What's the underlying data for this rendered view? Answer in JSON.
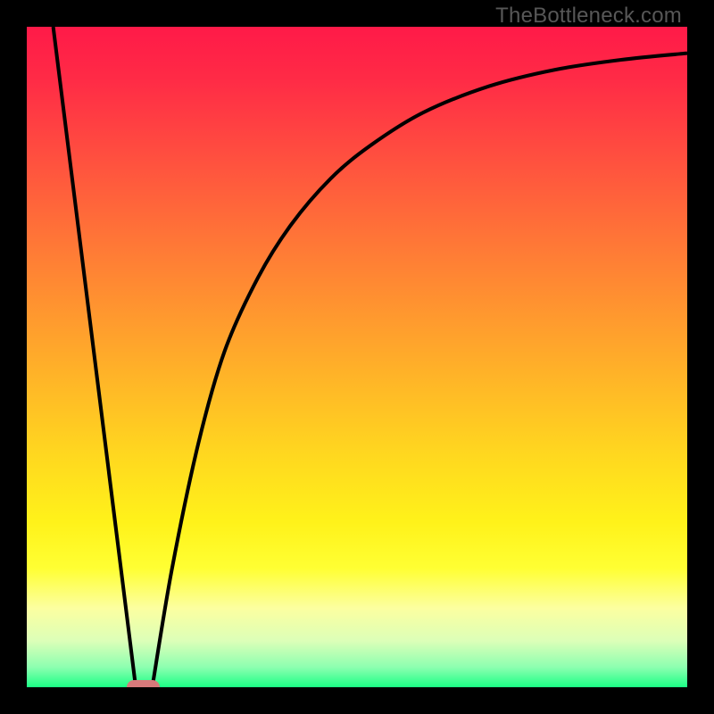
{
  "watermark": "TheBottleneck.com",
  "colors": {
    "gradient_stops": [
      {
        "offset": 0.0,
        "color": "#ff1a48"
      },
      {
        "offset": 0.08,
        "color": "#ff2b46"
      },
      {
        "offset": 0.2,
        "color": "#ff503f"
      },
      {
        "offset": 0.35,
        "color": "#ff7e35"
      },
      {
        "offset": 0.5,
        "color": "#ffab2a"
      },
      {
        "offset": 0.65,
        "color": "#ffd81f"
      },
      {
        "offset": 0.75,
        "color": "#fff21a"
      },
      {
        "offset": 0.82,
        "color": "#ffff33"
      },
      {
        "offset": 0.88,
        "color": "#fcffa0"
      },
      {
        "offset": 0.93,
        "color": "#dcffb8"
      },
      {
        "offset": 0.97,
        "color": "#8cffb0"
      },
      {
        "offset": 1.0,
        "color": "#1bff85"
      }
    ],
    "curve": "#000000",
    "marker": "#d77a7b",
    "frame": "#000000"
  },
  "chart_data": {
    "type": "line",
    "title": "",
    "xlabel": "",
    "ylabel": "",
    "xlim": [
      0,
      100
    ],
    "ylim": [
      0,
      100
    ],
    "series": [
      {
        "name": "left-line",
        "x": [
          4,
          16.5
        ],
        "values": [
          100,
          0
        ]
      },
      {
        "name": "right-curve",
        "x": [
          19,
          22,
          26,
          30,
          35,
          40,
          46,
          52,
          60,
          70,
          80,
          90,
          100
        ],
        "values": [
          0,
          18,
          37,
          51,
          62,
          70,
          77,
          82,
          87,
          91,
          93.5,
          95,
          96
        ]
      }
    ],
    "marker": {
      "x_start": 15.2,
      "x_end": 20.2,
      "y": 0
    }
  }
}
